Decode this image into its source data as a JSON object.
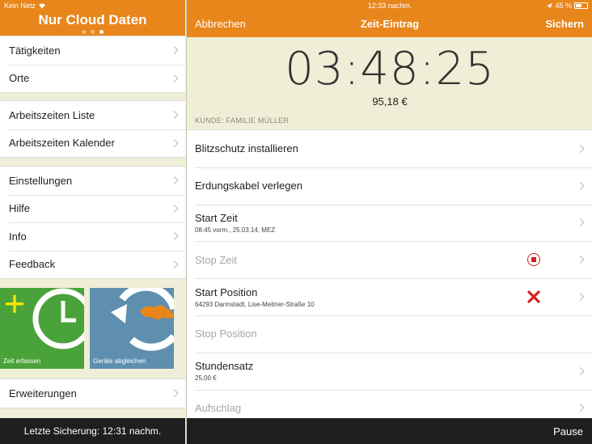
{
  "status": {
    "carrier": "Kein Netz",
    "time": "12:33 nachm.",
    "battery": "45 %"
  },
  "left": {
    "title": "Nur Cloud Daten",
    "group1": [
      {
        "label": "Tätigkeiten"
      },
      {
        "label": "Orte"
      }
    ],
    "group2": [
      {
        "label": "Arbeitszeiten Liste"
      },
      {
        "label": "Arbeitszeiten Kalender"
      }
    ],
    "group3": [
      {
        "label": "Einstellungen"
      },
      {
        "label": "Hilfe"
      },
      {
        "label": "Info"
      },
      {
        "label": "Feedback"
      }
    ],
    "tiles": {
      "record_label": "Zeit erfassen",
      "sync_label": "Geräte abgleichen"
    },
    "extensions": "Erweiterungen",
    "footer": "Letzte Sicherung: 12:31 nachm."
  },
  "right": {
    "nav": {
      "cancel": "Abbrechen",
      "title": "Zeit-Eintrag",
      "save": "Sichern"
    },
    "timer": "03:48:25",
    "amount": "95,18 €",
    "customer": "KUNDE: FAMILIE MÜLLER",
    "rows": [
      {
        "title": "Blitzschutz installieren",
        "sub": ""
      },
      {
        "title": "Erdungskabel verlegen",
        "sub": ""
      },
      {
        "title": "Start Zeit",
        "sub": "08:45 vorm., 25.03.14, MEZ"
      },
      {
        "title": "Stop Zeit",
        "sub": ""
      },
      {
        "title": "Start Position",
        "sub": "64293 Darmstadt, Lise-Meitner-Straße 10"
      },
      {
        "title": "Stop Position",
        "sub": ""
      },
      {
        "title": "Stundensatz",
        "sub": "25,00 €"
      },
      {
        "title": "Aufschlag",
        "sub": ""
      }
    ],
    "footer_button": "Pause"
  },
  "colors": {
    "accent": "#e8861c",
    "background": "#efeed6",
    "footer": "#1f1f1f",
    "alert_red": "#d1211c",
    "tile_green": "#4aa23a",
    "tile_blue": "#5e8fae"
  },
  "icons": [
    "wifi-icon",
    "location-arrow-icon",
    "battery-icon",
    "chevron-right-icon",
    "stop-icon",
    "delete-x-icon",
    "add-clock-icon",
    "sync-icon"
  ]
}
